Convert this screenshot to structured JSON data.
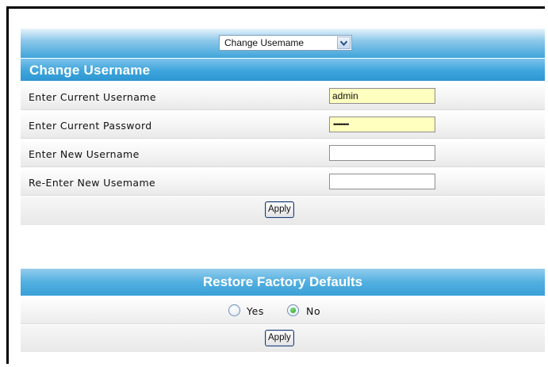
{
  "select": {
    "value": "Change Usemame"
  },
  "change_username": {
    "title": "Change Username",
    "rows": [
      {
        "label": "Enter Current Username",
        "value": "admin"
      },
      {
        "label": "Enter Current Password",
        "value": "•••••••••"
      },
      {
        "label": "Enter New Username",
        "value": ""
      },
      {
        "label": "Re-Enter New Usemame",
        "value": ""
      }
    ],
    "apply_label": "Apply"
  },
  "restore": {
    "title": "Restore Factory Defaults",
    "yes_label": "Yes",
    "no_label": "No",
    "selected": "No",
    "apply_label": "Apply"
  },
  "colors": {
    "bar_blue": "#3fa5da",
    "autofill_yellow": "#ffffc0",
    "radio_green": "#1f9a1f"
  }
}
